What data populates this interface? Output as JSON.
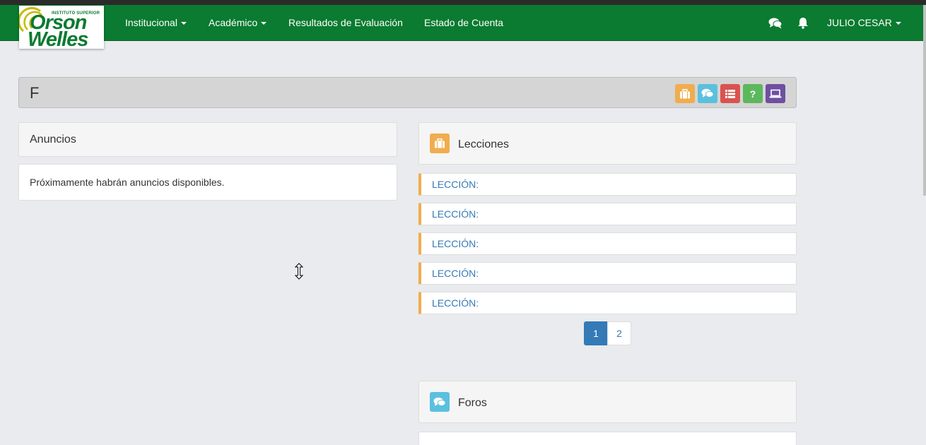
{
  "navbar": {
    "logo": {
      "small_text": "INSTITUTO SUPERIOR",
      "line1": "Orson",
      "line2": "Welles"
    },
    "items": [
      {
        "label": "Institucional",
        "has_caret": true
      },
      {
        "label": "Académico",
        "has_caret": true
      },
      {
        "label": "Resultados de Evaluación",
        "has_caret": false
      },
      {
        "label": "Estado de Cuenta",
        "has_caret": false
      }
    ],
    "icons": [
      "comments-icon",
      "bell-icon"
    ],
    "user_label": "JULIO CESAR"
  },
  "course": {
    "title": "F",
    "toolbar": [
      {
        "icon": "briefcase-icon",
        "color": "#f0ad4e"
      },
      {
        "icon": "comments-icon",
        "color": "#5bc0de"
      },
      {
        "icon": "list-icon",
        "color": "#d9534f"
      },
      {
        "icon": "question-icon",
        "color": "#5cb85c"
      },
      {
        "icon": "laptop-icon",
        "color": "#6f4fa1"
      }
    ]
  },
  "anuncios": {
    "title": "Anuncios",
    "empty_text": "Próximamente habrán anuncios disponibles."
  },
  "lecciones": {
    "title": "Lecciones",
    "items": [
      {
        "label": "LECCIÓN:"
      },
      {
        "label": "LECCIÓN:"
      },
      {
        "label": "LECCIÓN:"
      },
      {
        "label": "LECCIÓN:"
      },
      {
        "label": "LECCIÓN:"
      }
    ],
    "pagination": {
      "pages": [
        "1",
        "2"
      ],
      "current": "1"
    }
  },
  "foros": {
    "title": "Foros"
  },
  "colors": {
    "navbar": "#0a7b30",
    "accent": "#337ab7",
    "lesson_border": "#f0ad4e"
  }
}
